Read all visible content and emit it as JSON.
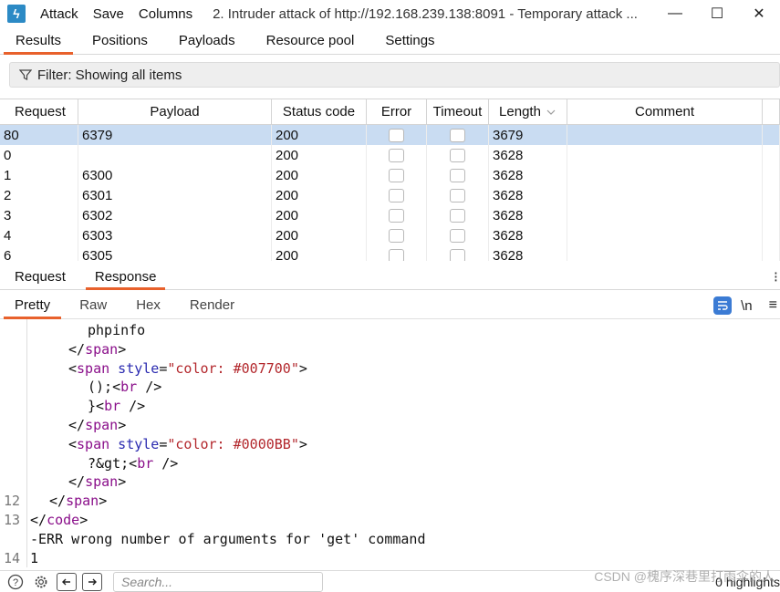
{
  "titlebar": {
    "app_icon": "burp-logo-icon",
    "menu": [
      "Attack",
      "Save",
      "Columns"
    ],
    "window_title": "2. Intruder attack of http://192.168.239.138:8091 - Temporary attack ...",
    "controls": {
      "minimize": "—",
      "maximize": "☐",
      "close": "✕"
    }
  },
  "main_tabs": [
    {
      "label": "Results",
      "active": true
    },
    {
      "label": "Positions",
      "active": false
    },
    {
      "label": "Payloads",
      "active": false
    },
    {
      "label": "Resource pool",
      "active": false
    },
    {
      "label": "Settings",
      "active": false
    }
  ],
  "filter": {
    "label": "Filter: Showing all items",
    "icon": "funnel-icon"
  },
  "table": {
    "headers": {
      "request": "Request",
      "payload": "Payload",
      "status": "Status code",
      "error": "Error",
      "timeout": "Timeout",
      "length": "Length",
      "comment": "Comment"
    },
    "sort_icon": "chevron-down-icon",
    "rows": [
      {
        "request": "80",
        "payload": "6379",
        "status": "200",
        "length": "3679",
        "comment": "",
        "selected": true
      },
      {
        "request": "0",
        "payload": "",
        "status": "200",
        "length": "3628",
        "comment": "",
        "selected": false
      },
      {
        "request": "1",
        "payload": "6300",
        "status": "200",
        "length": "3628",
        "comment": "",
        "selected": false
      },
      {
        "request": "2",
        "payload": "6301",
        "status": "200",
        "length": "3628",
        "comment": "",
        "selected": false
      },
      {
        "request": "3",
        "payload": "6302",
        "status": "200",
        "length": "3628",
        "comment": "",
        "selected": false
      },
      {
        "request": "4",
        "payload": "6303",
        "status": "200",
        "length": "3628",
        "comment": "",
        "selected": false
      },
      {
        "request": "6",
        "payload": "6305",
        "status": "200",
        "length": "3628",
        "comment": "",
        "selected": false
      }
    ]
  },
  "rr_tabs": [
    {
      "label": "Request",
      "active": false
    },
    {
      "label": "Response",
      "active": true
    }
  ],
  "rr_more": "⁝",
  "view_tabs": [
    {
      "label": "Pretty",
      "active": true
    },
    {
      "label": "Raw",
      "active": false
    },
    {
      "label": "Hex",
      "active": false
    },
    {
      "label": "Render",
      "active": false
    }
  ],
  "view_icons": {
    "wrap": "word-wrap-icon",
    "newline": "\\n",
    "menu": "≡"
  },
  "code_lines": [
    {
      "num": "",
      "indent": 3,
      "tokens": [
        {
          "t": "phpinfo",
          "c": "plain"
        }
      ]
    },
    {
      "num": "",
      "indent": 2,
      "tokens": [
        {
          "t": "</",
          "c": "plain"
        },
        {
          "t": "span",
          "c": "tag"
        },
        {
          "t": ">",
          "c": "plain"
        }
      ]
    },
    {
      "num": "",
      "indent": 2,
      "tokens": [
        {
          "t": "<",
          "c": "plain"
        },
        {
          "t": "span",
          "c": "tag"
        },
        {
          "t": " style",
          "c": "attr"
        },
        {
          "t": "=",
          "c": "plain"
        },
        {
          "t": "\"color: #007700\"",
          "c": "str"
        },
        {
          "t": ">",
          "c": "plain"
        }
      ]
    },
    {
      "num": "",
      "indent": 3,
      "tokens": [
        {
          "t": "();<",
          "c": "plain"
        },
        {
          "t": "br",
          "c": "tag"
        },
        {
          "t": " />",
          "c": "plain"
        }
      ]
    },
    {
      "num": "",
      "indent": 3,
      "tokens": [
        {
          "t": "}<",
          "c": "plain"
        },
        {
          "t": "br",
          "c": "tag"
        },
        {
          "t": " />",
          "c": "plain"
        }
      ]
    },
    {
      "num": "",
      "indent": 2,
      "tokens": [
        {
          "t": "</",
          "c": "plain"
        },
        {
          "t": "span",
          "c": "tag"
        },
        {
          "t": ">",
          "c": "plain"
        }
      ]
    },
    {
      "num": "",
      "indent": 2,
      "tokens": [
        {
          "t": "<",
          "c": "plain"
        },
        {
          "t": "span",
          "c": "tag"
        },
        {
          "t": " style",
          "c": "attr"
        },
        {
          "t": "=",
          "c": "plain"
        },
        {
          "t": "\"color: #0000BB\"",
          "c": "str"
        },
        {
          "t": ">",
          "c": "plain"
        }
      ]
    },
    {
      "num": "",
      "indent": 3,
      "tokens": [
        {
          "t": "?&gt;<",
          "c": "plain"
        },
        {
          "t": "br",
          "c": "tag"
        },
        {
          "t": " />",
          "c": "plain"
        }
      ]
    },
    {
      "num": "",
      "indent": 2,
      "tokens": [
        {
          "t": "</",
          "c": "plain"
        },
        {
          "t": "span",
          "c": "tag"
        },
        {
          "t": ">",
          "c": "plain"
        }
      ]
    },
    {
      "num": "12",
      "indent": 1,
      "tokens": [
        {
          "t": "</",
          "c": "plain"
        },
        {
          "t": "span",
          "c": "tag"
        },
        {
          "t": ">",
          "c": "plain"
        }
      ]
    },
    {
      "num": "13",
      "indent": 0,
      "tokens": [
        {
          "t": "</",
          "c": "plain"
        },
        {
          "t": "code",
          "c": "tag"
        },
        {
          "t": ">",
          "c": "plain"
        }
      ]
    },
    {
      "num": "",
      "indent": 0,
      "tokens": [
        {
          "t": "-ERR wrong number of arguments for 'get' command",
          "c": "plain"
        }
      ]
    },
    {
      "num": "14",
      "indent": 0,
      "tokens": [
        {
          "t": "1",
          "c": "plain"
        }
      ]
    }
  ],
  "bottom": {
    "help_icon": "help-icon",
    "settings_icon": "gear-icon",
    "back_icon": "arrow-left-icon",
    "forward_icon": "arrow-right-icon",
    "search_placeholder": "Search...",
    "highlights": "0 highlights"
  },
  "watermark": "CSDN @槐序深巷里打雨伞的人",
  "colors": {
    "accent_tab": "#e8612c",
    "selected_row": "#c9dcf2",
    "app_icon": "#2c8ac5",
    "tag": "#8a0f8a",
    "attr": "#2b2bb0",
    "string": "#b3282d"
  }
}
